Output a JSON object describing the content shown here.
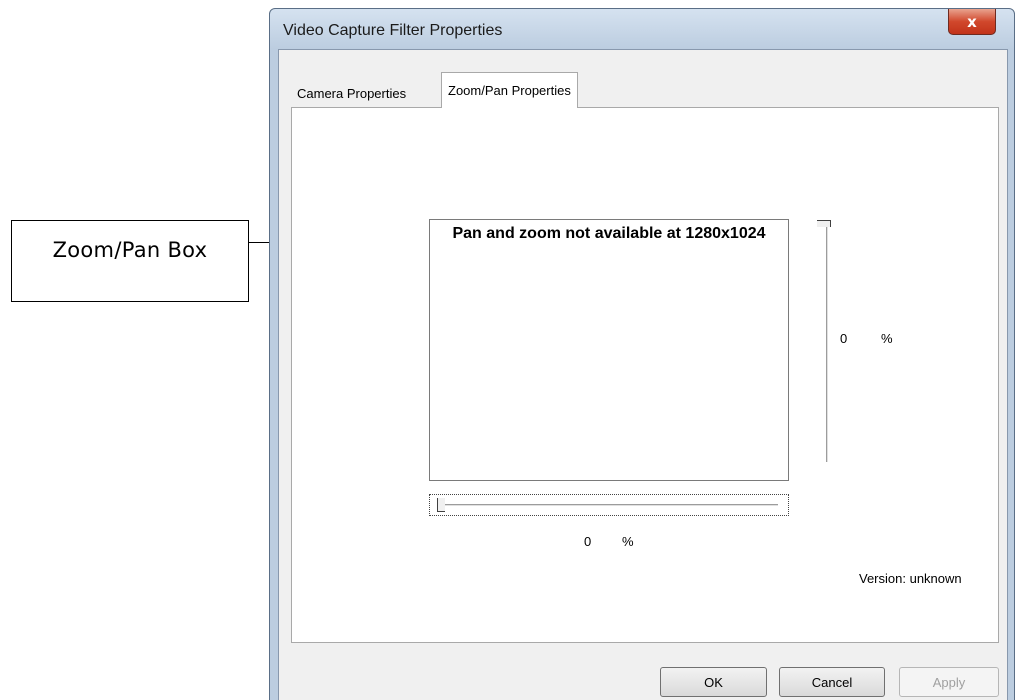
{
  "callout": {
    "label": "Zoom/Pan Box"
  },
  "window": {
    "title": "Video Capture Filter Properties",
    "close_icon": "close-icon",
    "close_glyph": "x"
  },
  "tabs": [
    {
      "label": "Camera Properties"
    },
    {
      "label": "Zoom/Pan Properties"
    }
  ],
  "zoom_pan": {
    "message": "Pan and zoom not available at 1280x1024",
    "vertical_value": "0",
    "vertical_unit": "%",
    "vertical_level": 0,
    "horizontal_value": "0",
    "horizontal_unit": "%",
    "horizontal_level": 0,
    "version": "Version: unknown"
  },
  "buttons": {
    "ok": "OK",
    "cancel": "Cancel",
    "apply": "Apply"
  }
}
